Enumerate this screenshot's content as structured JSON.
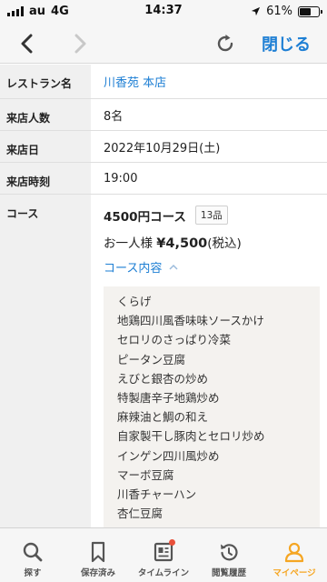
{
  "status": {
    "carrier": "au",
    "network": "4G",
    "time": "14:37",
    "battery_percent": "61%",
    "battery_level": 0.61
  },
  "nav": {
    "close_label": "閉じる"
  },
  "info": {
    "restaurant_label": "レストラン名",
    "restaurant_value": "川香苑 本店",
    "party_label": "来店人数",
    "party_value": "8名",
    "date_label": "来店日",
    "date_value": "2022年10月29日(土)",
    "time_label": "来店時刻",
    "time_value": "19:00",
    "course_label": "コース"
  },
  "course": {
    "name": "4500円コース",
    "item_count": "13品",
    "price_prefix": "お一人様",
    "price": "¥4,500",
    "price_suffix": "(税込)",
    "toggle_label": "コース内容",
    "dishes": [
      "くらげ",
      "地鶏四川風香味味ソースかけ",
      "セロリのさっぱり冷菜",
      "ピータン豆腐",
      "えびと銀杏の炒め",
      "特製唐辛子地鶏炒め",
      "麻辣油と鯛の和え",
      "自家製干し豚肉とセロリ炒め",
      "インゲン四川風炒め",
      "マーボ豆腐",
      "川香チャーハン",
      "杏仁豆腐"
    ]
  },
  "tabs": [
    {
      "label": "探す",
      "icon": "search-icon"
    },
    {
      "label": "保存済み",
      "icon": "bookmark-icon"
    },
    {
      "label": "タイムライン",
      "icon": "timeline-icon"
    },
    {
      "label": "閲覧履歴",
      "icon": "history-icon"
    },
    {
      "label": "マイページ",
      "icon": "person-icon"
    }
  ],
  "colors": {
    "accent_blue": "#1e7fd4",
    "active_tab": "#f5a623",
    "notification_dot": "#e8503a"
  }
}
